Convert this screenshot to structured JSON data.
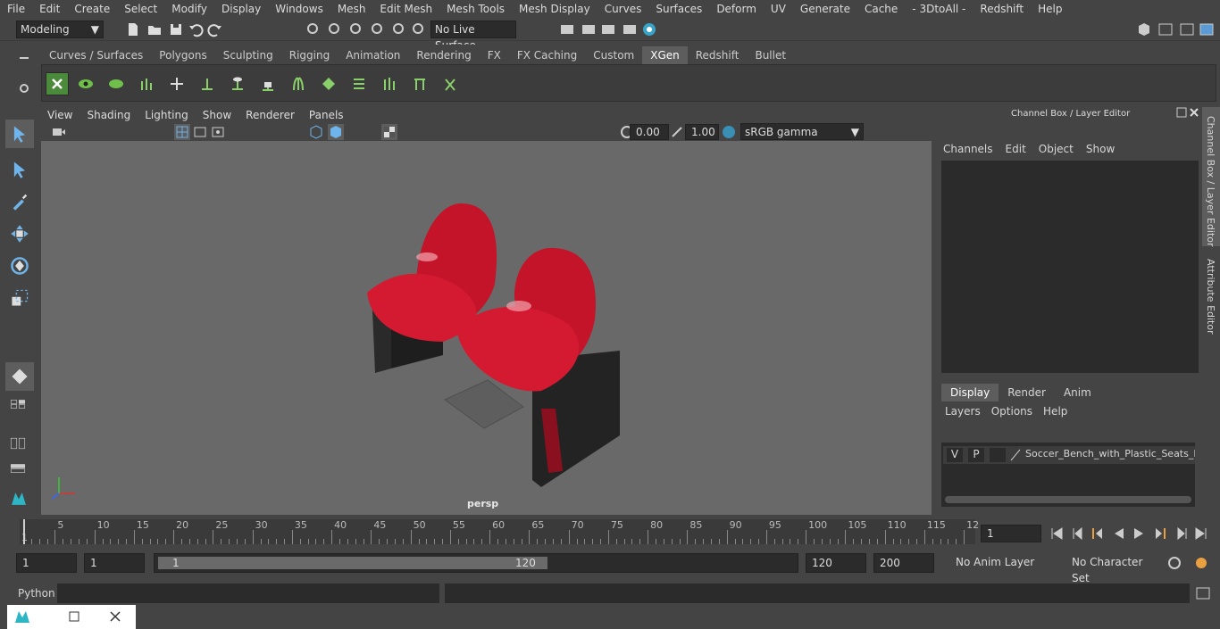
{
  "menubar": [
    "File",
    "Edit",
    "Create",
    "Select",
    "Modify",
    "Display",
    "Windows",
    "Mesh",
    "Edit Mesh",
    "Mesh Tools",
    "Mesh Display",
    "Curves",
    "Surfaces",
    "Deform",
    "UV",
    "Generate",
    "Cache",
    "- 3DtoAll -",
    "Redshift",
    "Help"
  ],
  "status": {
    "mode": "Modeling",
    "live_surface": "No Live Surface"
  },
  "shelf_tabs": [
    "Curves / Surfaces",
    "Polygons",
    "Sculpting",
    "Rigging",
    "Animation",
    "Rendering",
    "FX",
    "FX Caching",
    "Custom",
    "XGen",
    "Redshift",
    "Bullet"
  ],
  "shelf_active": "XGen",
  "viewport": {
    "menus": [
      "View",
      "Shading",
      "Lighting",
      "Show",
      "Renderer",
      "Panels"
    ],
    "exposure": "0.00",
    "gamma": "1.00",
    "colorspace": "sRGB gamma",
    "camera": "persp"
  },
  "channel_box": {
    "title": "Channel Box / Layer Editor",
    "menus": [
      "Channels",
      "Edit",
      "Object",
      "Show"
    ],
    "tabs": [
      "Display",
      "Render",
      "Anim"
    ],
    "active_tab": "Display",
    "layer_menus": [
      "Layers",
      "Options",
      "Help"
    ],
    "layer": {
      "v": "V",
      "p": "P",
      "name": "Soccer_Bench_with_Plastic_Seats_For..."
    }
  },
  "side_tabs": [
    "Channel Box / Layer Editor",
    "Attribute Editor"
  ],
  "timeline": {
    "ticks": [
      "5",
      "10",
      "15",
      "20",
      "25",
      "30",
      "35",
      "40",
      "45",
      "50",
      "55",
      "60",
      "65",
      "70",
      "75",
      "80",
      "85",
      "90",
      "95",
      "100",
      "105",
      "110",
      "115",
      "12"
    ],
    "start_label": "1",
    "current_frame": "1"
  },
  "range": {
    "start": "1",
    "playback_start": "1",
    "slider_start": "1",
    "slider_end": "120",
    "end": "120",
    "anim_end": "200",
    "anim_layer": "No Anim Layer",
    "char_set": "No Character Set"
  },
  "cmdline": {
    "label": "Python"
  },
  "colors": {
    "accent": "#5a9bd5",
    "seat": "#d0182a"
  }
}
